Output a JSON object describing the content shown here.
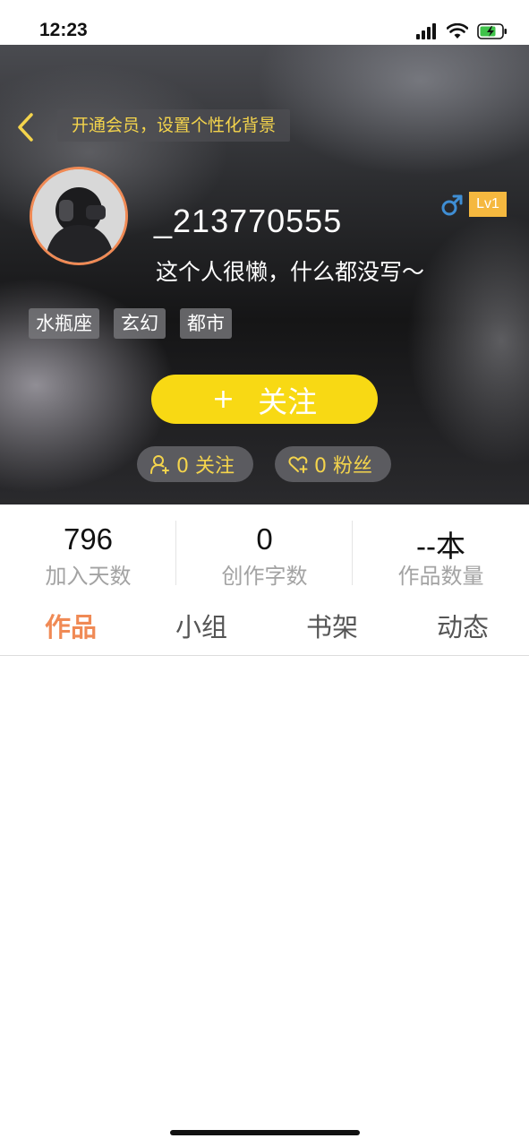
{
  "status_bar": {
    "time": "12:23",
    "icons": [
      "signal-icon",
      "wifi-icon",
      "battery-charging-icon"
    ]
  },
  "header": {
    "back_icon": "chevron-left-icon",
    "vip_banner": "开通会员，设置个性化背景",
    "username": "_213770555",
    "bio": "这个人很懒，什么都没写～",
    "gender_icon": "male-icon",
    "level": "Lv1",
    "tags": [
      "水瓶座",
      "玄幻",
      "都市"
    ],
    "follow_button": {
      "plus": "+",
      "label": "关注"
    },
    "following_count": "0 关注",
    "fans_count": "0 粉丝"
  },
  "stats": [
    {
      "value": "796",
      "label": "加入天数"
    },
    {
      "value": "0",
      "label": "创作字数"
    },
    {
      "value": "--本",
      "label": "作品数量"
    }
  ],
  "tabs": [
    {
      "label": "作品",
      "active": true
    },
    {
      "label": "小组",
      "active": false
    },
    {
      "label": "书架",
      "active": false
    },
    {
      "label": "动态",
      "active": false
    }
  ],
  "colors": {
    "accent_orange": "#f08a55",
    "follow_yellow": "#f8d914",
    "banner_text_yellow": "#f4d44c",
    "level_badge": "#f5b83f",
    "male_blue": "#3f8ed4"
  }
}
